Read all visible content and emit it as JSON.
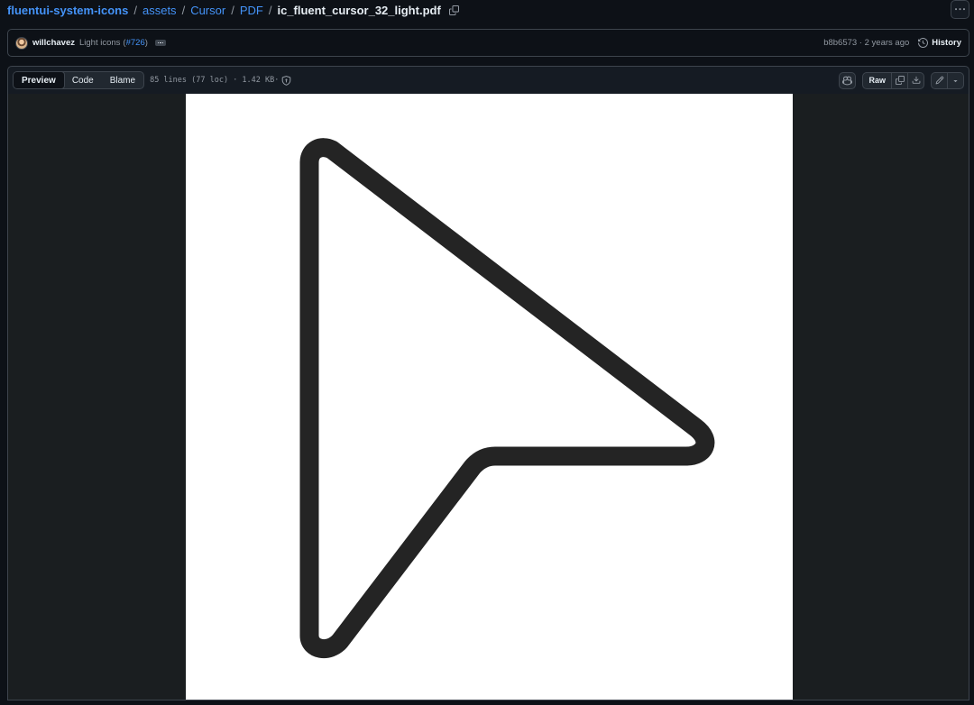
{
  "breadcrumb": {
    "repo": "fluentui-system-icons",
    "sep": "/",
    "parts": [
      "assets",
      "Cursor",
      "PDF"
    ],
    "file": "ic_fluent_cursor_32_light.pdf"
  },
  "commit": {
    "author": "willchavez",
    "message": "Light icons",
    "pr_open": "(",
    "pr": "#726",
    "pr_close": ")",
    "sha_and_time": "b8b6573 · 2 years ago",
    "history_label": "History"
  },
  "file_header": {
    "tabs": [
      "Preview",
      "Code",
      "Blame"
    ],
    "active_tab": "Preview",
    "meta": "85 lines (77 loc) · 1.42 KB·",
    "raw_label": "Raw"
  },
  "preview": {
    "content_icon": "cursor-arrow-icon",
    "page_color": "#ffffff",
    "stroke_color": "#242424"
  },
  "colors": {
    "background": "#0d1117",
    "link": "#4493f8",
    "muted": "#9198a1",
    "border": "#3d444d"
  }
}
